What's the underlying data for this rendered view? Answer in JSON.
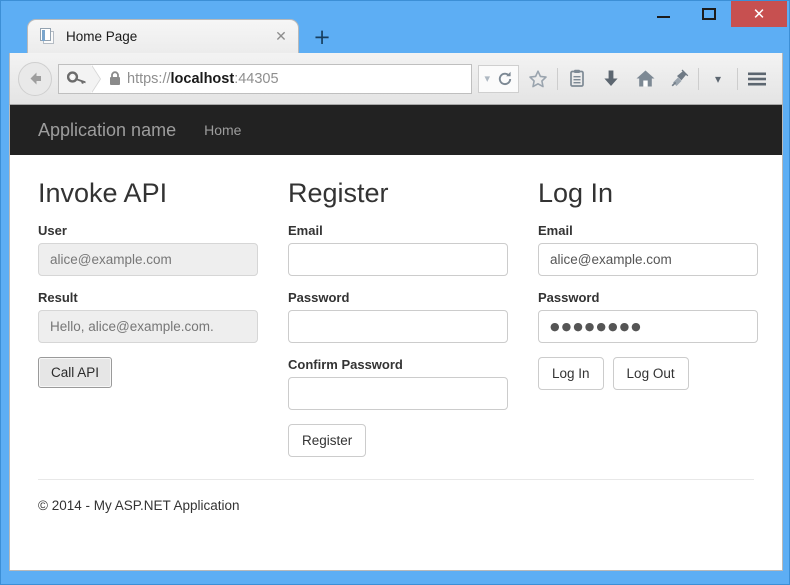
{
  "window": {
    "controls": {
      "minimize": "—",
      "maximize": "☐",
      "close": "✕"
    }
  },
  "browser": {
    "tab": {
      "title": "Home Page",
      "close_label": "✕",
      "favicon": "page-icon"
    },
    "new_tab_label": "+",
    "back_label": "←",
    "urlbar": {
      "identity_icon": "key-icon",
      "lock_icon": "padlock-icon",
      "scheme": "https://",
      "host": "localhost",
      "port": ":44305",
      "full_url": "https://localhost:44305"
    },
    "toolbar": {
      "dropmarker": "▾",
      "reload": "reload-icon",
      "bookmark": "star-icon",
      "reading_list": "reading-list-icon",
      "downloads": "download-arrow-icon",
      "home": "home-icon",
      "pin": "pin-icon",
      "overflow": "▾",
      "menu": "hamburger-menu-icon"
    }
  },
  "site": {
    "brand": "Application name",
    "nav": [
      {
        "label": "Home"
      }
    ],
    "columns": [
      {
        "id": "invoke-api",
        "heading": "Invoke API",
        "fields": [
          {
            "id": "user",
            "label": "User",
            "value": "alice@example.com",
            "readonly": true
          },
          {
            "id": "result",
            "label": "Result",
            "value": "Hello, alice@example.com.",
            "readonly": true
          }
        ],
        "buttons": [
          {
            "id": "call-api",
            "label": "Call API",
            "style": "native"
          }
        ]
      },
      {
        "id": "register",
        "heading": "Register",
        "fields": [
          {
            "id": "register-email",
            "label": "Email",
            "value": "",
            "readonly": false
          },
          {
            "id": "register-password",
            "label": "Password",
            "value": "",
            "readonly": false
          },
          {
            "id": "register-confirm-password",
            "label": "Confirm Password",
            "value": "",
            "readonly": false
          }
        ],
        "buttons": [
          {
            "id": "register",
            "label": "Register",
            "style": "bootstrap"
          }
        ]
      },
      {
        "id": "log-in",
        "heading": "Log In",
        "fields": [
          {
            "id": "login-email",
            "label": "Email",
            "value": "alice@example.com",
            "readonly": false
          },
          {
            "id": "login-password",
            "label": "Password",
            "value": "●●●●●●●●",
            "readonly": false,
            "masked": true
          }
        ],
        "buttons": [
          {
            "id": "log-in",
            "label": "Log In",
            "style": "bootstrap"
          },
          {
            "id": "log-out",
            "label": "Log Out",
            "style": "bootstrap"
          }
        ]
      }
    ],
    "footer": "© 2014 - My ASP.NET Application"
  },
  "colors": {
    "window_frame": "#5daef4",
    "close_button": "#c75050",
    "navbar_dark": "#222222",
    "navbar_text": "#9d9d9d",
    "readonly_field": "#eeeeee"
  }
}
